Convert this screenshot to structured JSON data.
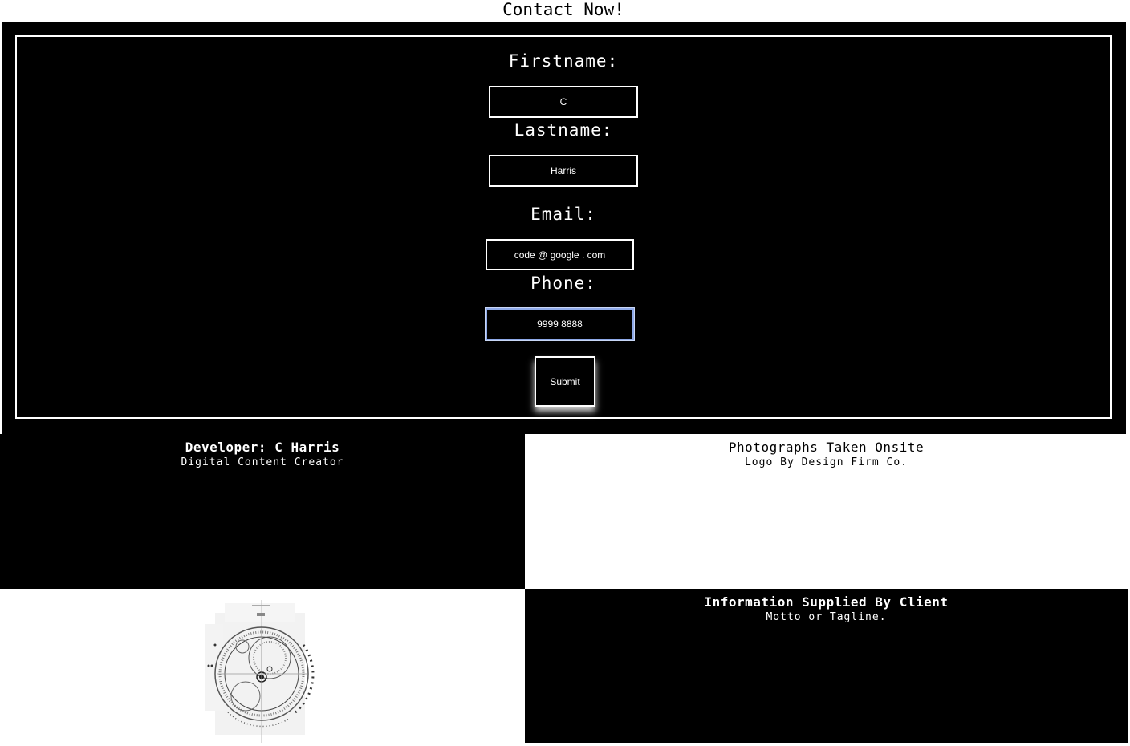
{
  "page": {
    "title": "Contact Now!"
  },
  "form": {
    "firstname": {
      "label": "Firstname:",
      "value": "C"
    },
    "lastname": {
      "label": "Lastname:",
      "value": "Harris"
    },
    "email": {
      "label": "Email:",
      "value": "code @ google . com"
    },
    "phone": {
      "label": "Phone:",
      "value": "9999 8888"
    },
    "submit_label": "Submit"
  },
  "panels": {
    "developer": {
      "heading": "Developer: C Harris",
      "sub": "Digital Content Creator"
    },
    "photos": {
      "heading": "Photographs Taken Onsite",
      "sub": "Logo By Design Firm Co."
    },
    "client": {
      "heading": "Information Supplied By Client",
      "sub": "Motto or Tagline."
    },
    "logo": {
      "icon": "circular-astrolabe-logo-icon"
    }
  },
  "colors": {
    "background": "#000000",
    "foreground": "#ffffff",
    "focus_border": "#8ea9e8"
  }
}
